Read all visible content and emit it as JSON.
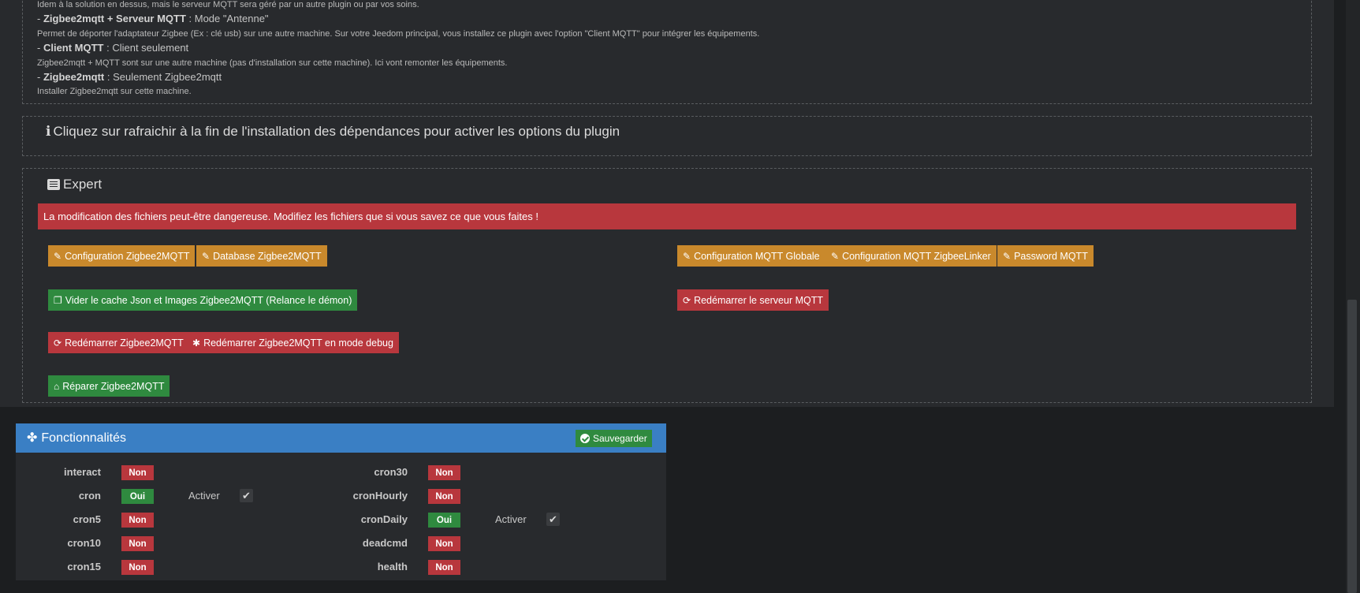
{
  "description": {
    "line1": "Idem à la solution en dessus, mais le serveur MQTT sera géré par un autre plugin ou par vos soins.",
    "opt1_name": "Zigbee2mqtt + Serveur MQTT",
    "opt1_mode": " : Mode \"Antenne\"",
    "opt1_desc": "Permet de déporter l'adaptateur Zigbee (Ex : clé usb) sur une autre machine. Sur votre Jeedom principal, vous installez ce plugin avec l'option \"Client MQTT\" pour intégrer les équipements.",
    "opt2_name": "Client MQTT",
    "opt2_mode": " : Client seulement",
    "opt2_desc": "Zigbee2mqtt + MQTT sont sur une autre machine (pas d'installation sur cette machine). Ici vont remonter les équipements.",
    "opt3_name": "Zigbee2mqtt",
    "opt3_mode": " : Seulement Zigbee2mqtt",
    "opt3_desc": "Installer Zigbee2mqtt sur cette machine.",
    "dash": "- "
  },
  "info": {
    "glyph": "i",
    "text": "Cliquez sur rafraichir à la fin de l'installation des dépendances pour activer les options du plugin"
  },
  "expert": {
    "title": "Expert",
    "warning": "La modification des fichiers peut-être dangereuse. Modifiez les fichiers que si vous savez ce que vous faites !",
    "buttons": {
      "config_z2m": "Configuration Zigbee2MQTT",
      "db_z2m": "Database Zigbee2MQTT",
      "config_mqtt_global": "Configuration MQTT Globale",
      "config_mqtt_linker": "Configuration MQTT ZigbeeLinker",
      "password_mqtt": "Password MQTT",
      "clear_cache": "Vider le cache Json et Images Zigbee2MQTT (Relance le démon)",
      "restart_mqtt": "Redémarrer le serveur MQTT",
      "restart_z2m": "Redémarrer Zigbee2MQTT",
      "restart_z2m_debug": "Redémarrer Zigbee2MQTT en mode debug",
      "repair_z2m": "Réparer Zigbee2MQTT"
    }
  },
  "functionalities": {
    "title": "Fonctionnalités",
    "save": "Sauvegarder",
    "activate_label": "Activer",
    "left": [
      {
        "name": "interact",
        "status": "Non",
        "active": false
      },
      {
        "name": "cron",
        "status": "Oui",
        "active": true
      },
      {
        "name": "cron5",
        "status": "Non",
        "active": false
      },
      {
        "name": "cron10",
        "status": "Non",
        "active": false
      },
      {
        "name": "cron15",
        "status": "Non",
        "active": false
      }
    ],
    "right": [
      {
        "name": "cron30",
        "status": "Non",
        "active": false
      },
      {
        "name": "cronHourly",
        "status": "Non",
        "active": false
      },
      {
        "name": "cronDaily",
        "status": "Oui",
        "active": true
      },
      {
        "name": "deadcmd",
        "status": "Non",
        "active": false
      },
      {
        "name": "health",
        "status": "Non",
        "active": false
      }
    ]
  },
  "colors": {
    "background": "#1c1e20",
    "panel": "#282a2d",
    "orange": "#c9892c",
    "green": "#2f8a3f",
    "red": "#b8373d",
    "blue": "#3a7fc4"
  }
}
